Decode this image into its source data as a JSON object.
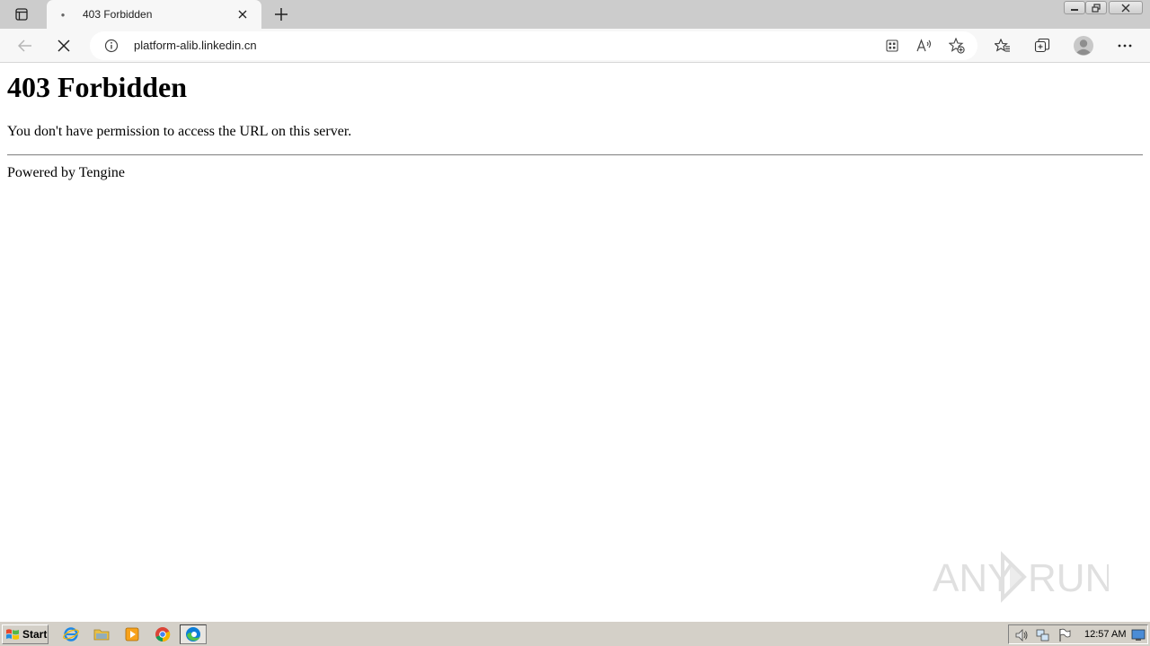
{
  "browser": {
    "tab": {
      "title": "403 Forbidden"
    },
    "address_bar": {
      "url": "platform-alib.linkedin.cn"
    },
    "icons": {
      "tab_actions": "tab-actions-icon",
      "tab_close": "close-icon",
      "new_tab": "plus-icon",
      "back": "back-arrow-icon",
      "stop": "stop-icon",
      "site_info": "info-icon",
      "app_available": "app-grid-icon",
      "read_aloud": "read-aloud-icon",
      "add_favorite": "star-plus-icon",
      "favorites": "favorites-icon",
      "collections": "collections-icon",
      "profile": "profile-avatar-icon",
      "more": "more-dots-icon"
    }
  },
  "page": {
    "title": "403 Forbidden",
    "message": "You don't have permission to access the URL on this server.",
    "footer": "Powered by Tengine"
  },
  "watermark": {
    "text": "ANY RUN"
  },
  "taskbar": {
    "start_label": "Start",
    "quick_launch": [
      "internet-explorer-icon",
      "folder-icon",
      "media-player-icon",
      "chrome-icon"
    ],
    "active_task": "edge-icon",
    "clock": "12:57 AM"
  },
  "colors": {
    "tabstrip": "#cccccc",
    "toolbar": "#f7f7f7",
    "taskbar": "#d4d0c8",
    "edge_blue": "#0c7ed8",
    "edge_green": "#4fc34a"
  }
}
